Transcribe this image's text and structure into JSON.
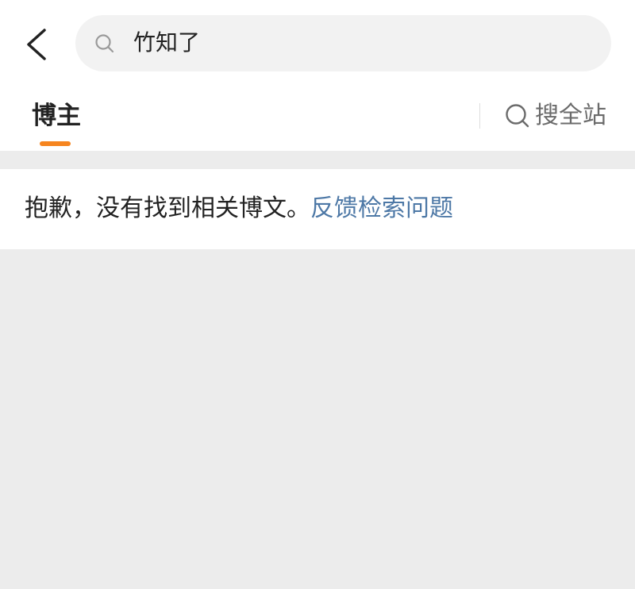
{
  "header": {
    "search": {
      "value": "竹知了"
    }
  },
  "tabs": {
    "active_label": "博主",
    "search_all_label": "搜全站"
  },
  "result": {
    "message": "抱歉，没有找到相关博文。",
    "feedback_link": "反馈检索问题"
  },
  "colors": {
    "accent": "#f6851f",
    "link": "#4d78a6",
    "background": "#ececec"
  },
  "icons": {
    "back": "chevron-left-icon",
    "search": "search-icon",
    "search_all": "search-icon"
  }
}
